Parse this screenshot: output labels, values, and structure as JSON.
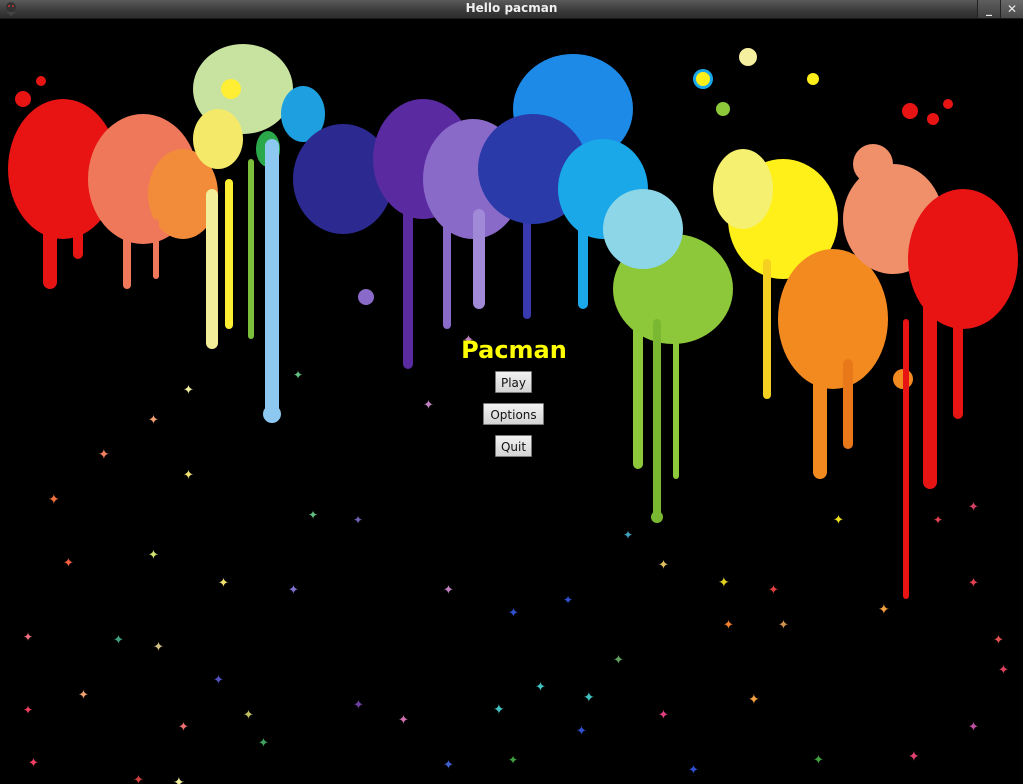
{
  "window": {
    "title": "Hello pacman",
    "controls": {
      "minimize_glyph": "_",
      "close_glyph": "✕"
    }
  },
  "menu": {
    "title": "Pacman",
    "buttons": {
      "play": "Play",
      "options": "Options",
      "quit": "Quit"
    }
  },
  "colors": {
    "title": "#ffff00",
    "background": "#000000",
    "button_bg": "#e0e0e0"
  },
  "background_art": "rainbow paint splatter with drips and scattered butterflies"
}
